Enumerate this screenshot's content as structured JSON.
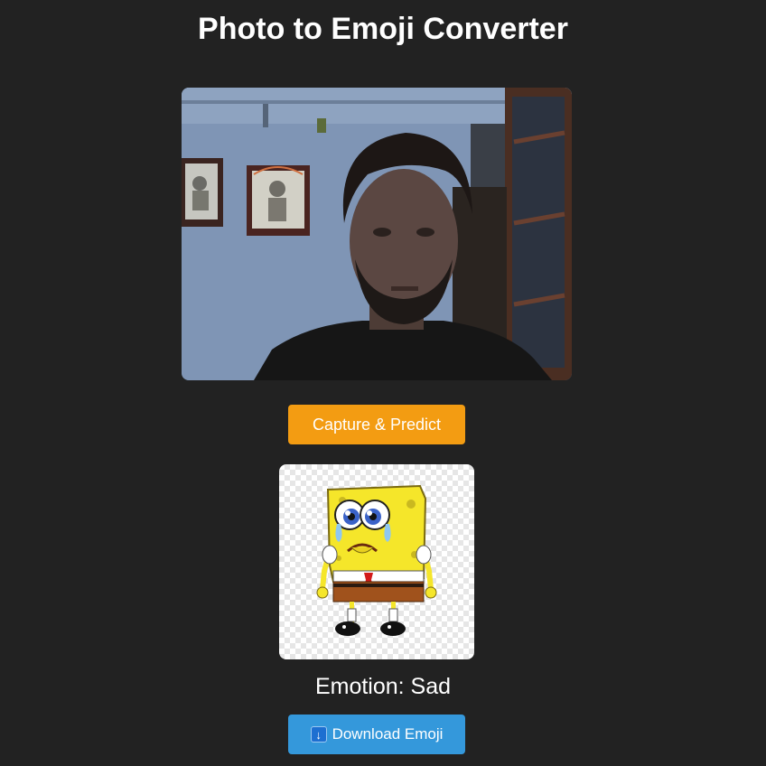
{
  "page": {
    "title": "Photo to Emoji Converter"
  },
  "camera": {
    "description_icon": "webcam-feed"
  },
  "capture_button": {
    "label": "Capture & Predict",
    "color": "#f39c12"
  },
  "result": {
    "emoji_icon": "spongebob-sad-emoji",
    "emotion_text": "Emotion: Sad"
  },
  "download_button": {
    "icon": "download-arrow-icon",
    "icon_glyph": "↓",
    "label": "Download Emoji",
    "color": "#3498db"
  },
  "colors": {
    "background": "#222222",
    "text": "#ffffff"
  }
}
